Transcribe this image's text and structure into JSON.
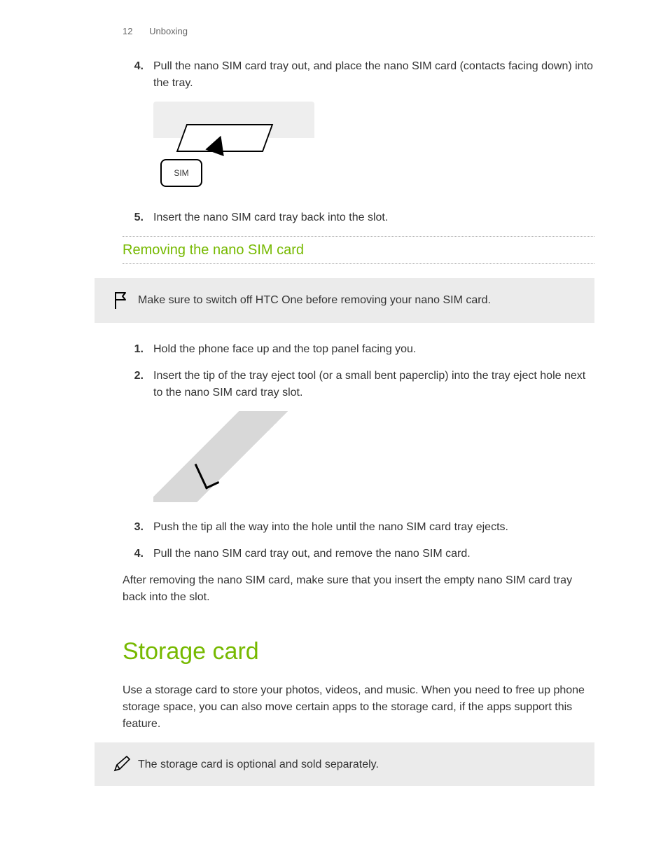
{
  "header": {
    "page_number": "12",
    "section_name": "Unboxing"
  },
  "steps_a": [
    {
      "num": "4.",
      "text": "Pull the nano SIM card tray out, and place the nano SIM card (contacts facing down) into the tray."
    },
    {
      "num": "5.",
      "text": "Insert the nano SIM card tray back into the slot."
    }
  ],
  "fig1_label": "SIM",
  "subheading": "Removing the nano SIM card",
  "note1": {
    "icon": "flag-icon",
    "text": "Make sure to switch off HTC One before removing your nano SIM card."
  },
  "steps_b": [
    {
      "num": "1.",
      "text": "Hold the phone face up and the top panel facing you."
    },
    {
      "num": "2.",
      "text": "Insert the tip of the tray eject tool (or a small bent paperclip) into the tray eject hole next to the nano SIM card tray slot."
    },
    {
      "num": "3.",
      "text": "Push the tip all the way into the hole until the nano SIM card tray ejects."
    },
    {
      "num": "4.",
      "text": "Pull the nano SIM card tray out, and remove the nano SIM card."
    }
  ],
  "post_steps_para": "After removing the nano SIM card, make sure that you insert the empty nano SIM card tray back into the slot.",
  "section_heading": "Storage card",
  "section_para": "Use a storage card to store your photos, videos, and music. When you need to free up phone storage space, you can also move certain apps to the storage card, if the apps support this feature.",
  "note2": {
    "icon": "pencil-icon",
    "text": "The storage card is optional and sold separately."
  }
}
